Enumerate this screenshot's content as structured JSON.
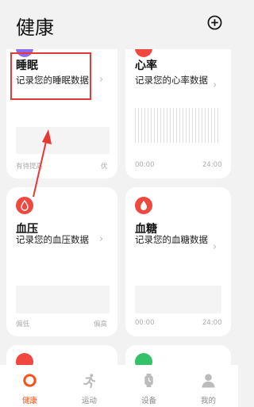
{
  "header": {
    "title": "健康"
  },
  "cards": {
    "sleep": {
      "title": "睡眠",
      "subtitle": "记录您的睡眠数据",
      "axis_left": "有待提高",
      "axis_right": "优"
    },
    "heart": {
      "title": "心率",
      "subtitle": "记录您的心率数据",
      "axis_left": "00:00",
      "axis_right": "24:00"
    },
    "bp": {
      "title": "血压",
      "subtitle": "记录您的血压数据",
      "axis_left": "偏低",
      "axis_right": "偏高"
    },
    "sugar": {
      "title": "血糖",
      "subtitle": "记录您的血糖数据",
      "axis_left": "00:00",
      "axis_right": "24:00"
    }
  },
  "tabs": [
    {
      "label": "健康",
      "icon": "health-ring-icon",
      "active": true
    },
    {
      "label": "运动",
      "icon": "running-icon",
      "active": false
    },
    {
      "label": "设备",
      "icon": "watch-icon",
      "active": false
    },
    {
      "label": "我的",
      "icon": "person-icon",
      "active": false
    }
  ],
  "colors": {
    "accent": "#f2541b",
    "icon_red": "#f0473e",
    "icon_purple": "#8b6cf0",
    "icon_green": "#34c16a",
    "highlight": "#e53935"
  }
}
